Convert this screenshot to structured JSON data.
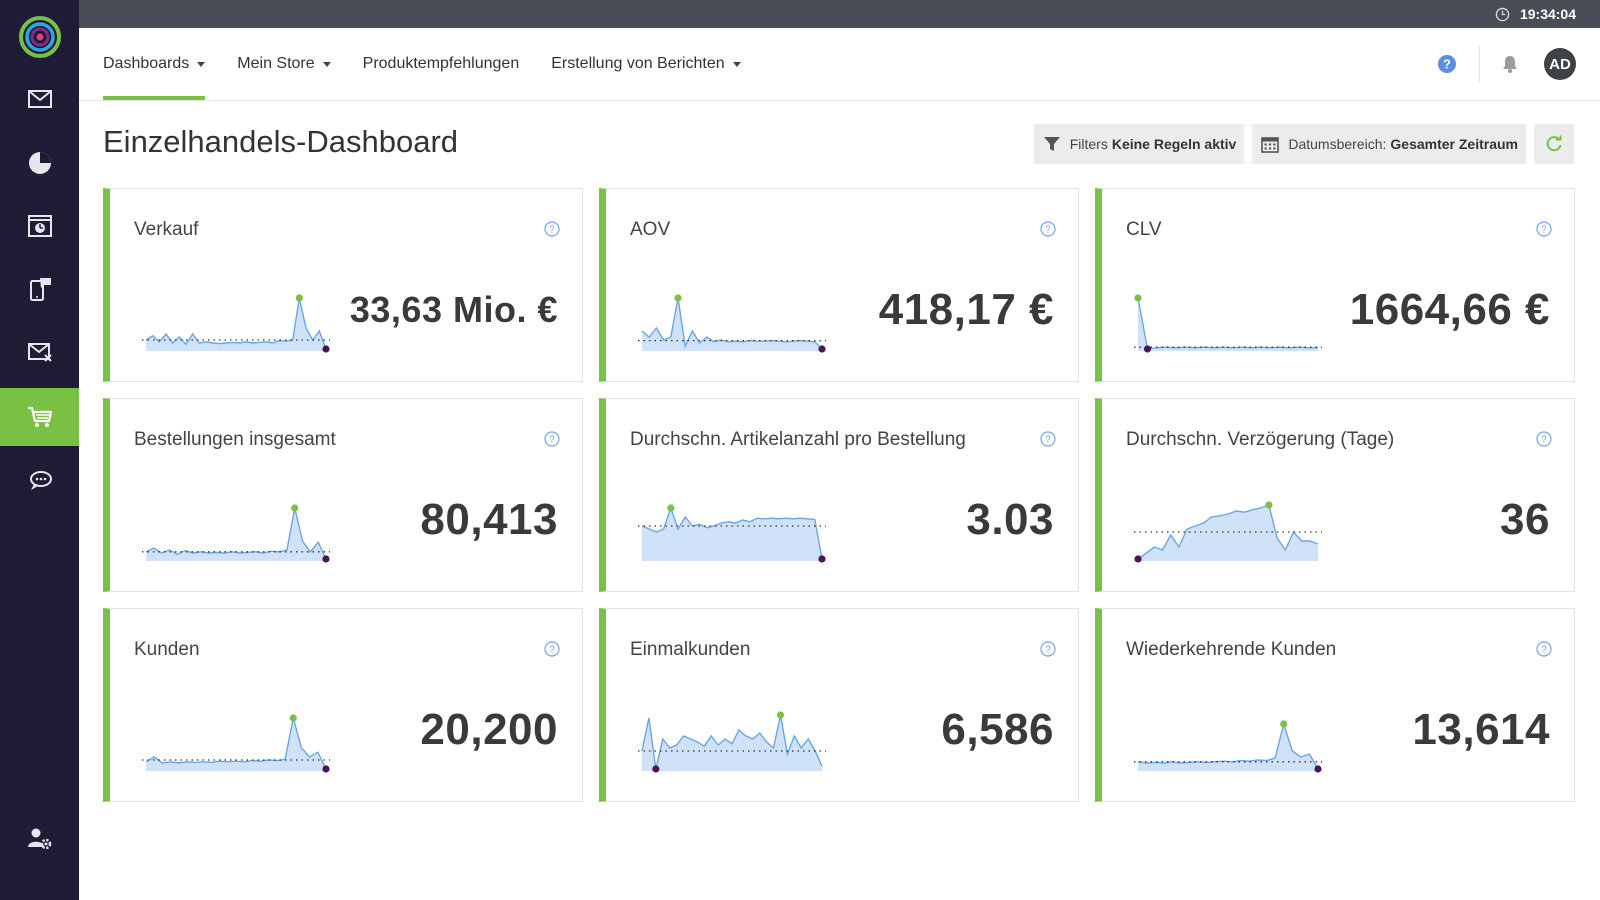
{
  "topbar": {
    "time": "19:34:04"
  },
  "header": {
    "menu": [
      {
        "label": "Dashboards",
        "dropdown": true
      },
      {
        "label": "Mein Store",
        "dropdown": true
      },
      {
        "label": "Produktempfehlungen",
        "dropdown": false
      },
      {
        "label": "Erstellung von Berichten",
        "dropdown": true
      }
    ],
    "avatar_initials": "AD"
  },
  "page": {
    "title": "Einzelhandels-Dashboard",
    "filters_label": "Filters",
    "filters_value": "Keine Regeln aktiv",
    "date_label": "Datumsbereich:",
    "date_value": "Gesamter Zeitraum"
  },
  "colors": {
    "accent": "#7ac143",
    "sidebar": "#1e1d35",
    "spark_line": "#6aa5e6",
    "spark_fill": "#cfe2f8",
    "max_marker": "#7ac143",
    "min_marker": "#4a1458"
  },
  "cards": [
    {
      "title": "Verkauf",
      "value": "33,63 Mio. €",
      "spark": [
        0.15,
        0.22,
        0.12,
        0.25,
        0.1,
        0.2,
        0.08,
        0.25,
        0.1,
        0.12,
        0.1,
        0.09,
        0.1,
        0.11,
        0.1,
        0.12,
        0.1,
        0.11,
        0.12,
        0.1,
        0.14,
        0.13,
        0.15,
        0.85,
        0.35,
        0.15,
        0.3,
        0.0
      ],
      "baseline": 0.15
    },
    {
      "title": "AOV",
      "value": "418,17 €",
      "spark": [
        0.3,
        0.2,
        0.35,
        0.15,
        0.2,
        0.85,
        0.05,
        0.3,
        0.1,
        0.2,
        0.12,
        0.15,
        0.12,
        0.13,
        0.12,
        0.14,
        0.13,
        0.13,
        0.14,
        0.13,
        0.12,
        0.13,
        0.14,
        0.13,
        0.12,
        0.0
      ],
      "baseline": 0.14
    },
    {
      "title": "CLV",
      "value": "1664,66 €",
      "spark": [
        0.85,
        0.0,
        0.02,
        0.03,
        0.02,
        0.03,
        0.02,
        0.03,
        0.02,
        0.03,
        0.02,
        0.03,
        0.02,
        0.03,
        0.02,
        0.03,
        0.02,
        0.03,
        0.02,
        0.02
      ],
      "baseline": 0.03
    },
    {
      "title": "Bestellungen insgesamt",
      "value": "80,413",
      "spark": [
        0.12,
        0.18,
        0.1,
        0.15,
        0.08,
        0.14,
        0.1,
        0.12,
        0.1,
        0.11,
        0.1,
        0.12,
        0.1,
        0.11,
        0.12,
        0.1,
        0.13,
        0.12,
        0.15,
        0.85,
        0.3,
        0.12,
        0.28,
        0.0
      ],
      "baseline": 0.12
    },
    {
      "title": "Durchschn. Artikelanzahl pro Bestellung",
      "value": "3.03",
      "spark": [
        0.55,
        0.5,
        0.45,
        0.5,
        0.85,
        0.5,
        0.7,
        0.55,
        0.58,
        0.52,
        0.55,
        0.6,
        0.62,
        0.6,
        0.65,
        0.62,
        0.68,
        0.67,
        0.68,
        0.67,
        0.68,
        0.67,
        0.68,
        0.67,
        0.66,
        0.0
      ],
      "baseline": 0.55
    },
    {
      "title": "Durchschn. Verzögerung (Tage)",
      "value": "36",
      "spark": [
        0.0,
        0.1,
        0.2,
        0.15,
        0.4,
        0.2,
        0.5,
        0.55,
        0.6,
        0.7,
        0.72,
        0.75,
        0.8,
        0.78,
        0.82,
        0.85,
        0.9,
        0.35,
        0.15,
        0.45,
        0.3,
        0.3,
        0.25
      ],
      "baseline": 0.45
    },
    {
      "title": "Kunden",
      "value": "20,200",
      "spark": [
        0.12,
        0.2,
        0.1,
        0.12,
        0.1,
        0.12,
        0.11,
        0.12,
        0.11,
        0.13,
        0.12,
        0.13,
        0.12,
        0.14,
        0.13,
        0.15,
        0.14,
        0.16,
        0.85,
        0.35,
        0.2,
        0.28,
        0.0
      ],
      "baseline": 0.15
    },
    {
      "title": "Einmalkunden",
      "value": "6,586",
      "spark": [
        0.3,
        0.85,
        0.0,
        0.5,
        0.35,
        0.4,
        0.55,
        0.5,
        0.45,
        0.38,
        0.55,
        0.4,
        0.5,
        0.42,
        0.65,
        0.55,
        0.5,
        0.6,
        0.45,
        0.35,
        0.9,
        0.25,
        0.55,
        0.35,
        0.5,
        0.3,
        0.05
      ],
      "baseline": 0.3
    },
    {
      "title": "Wiederkehrende Kunden",
      "value": "13,614",
      "spark": [
        0.12,
        0.1,
        0.11,
        0.1,
        0.12,
        0.1,
        0.11,
        0.12,
        0.11,
        0.12,
        0.13,
        0.12,
        0.14,
        0.13,
        0.15,
        0.14,
        0.18,
        0.75,
        0.3,
        0.2,
        0.25,
        0.0
      ],
      "baseline": 0.12
    }
  ],
  "sidebar_items": [
    "mail-icon",
    "pie-chart-icon",
    "browser-icon",
    "mobile-push-icon",
    "email-campaign-icon",
    "cart-icon",
    "chat-icon"
  ]
}
